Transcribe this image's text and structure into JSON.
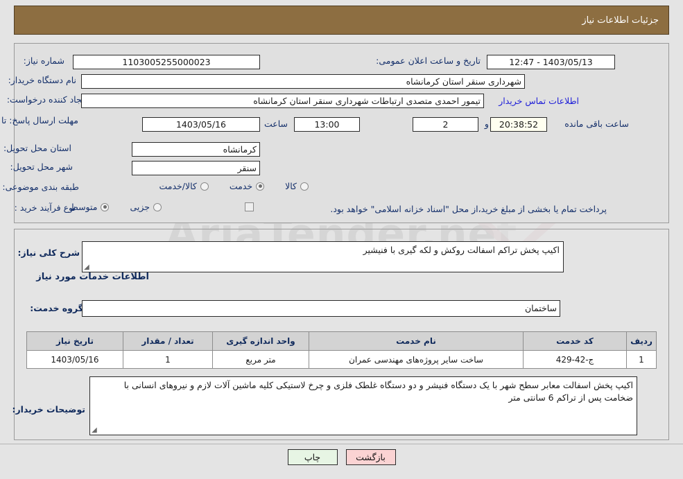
{
  "header": {
    "title": "جزئیات اطلاعات نیاز",
    "bar_color": "#8d6e41"
  },
  "watermark": {
    "text": "AriaTender.net"
  },
  "top_form": {
    "need_number_label": "شماره نیاز:",
    "need_number_value": "1103005255000023",
    "public_announce_label": "تاریخ و ساعت اعلان عمومی:",
    "public_announce_value": "1403/05/13 - 12:47",
    "buyer_org_label": "نام دستگاه خریدار:",
    "buyer_org_value": "شهرداری سنقر استان کرمانشاه",
    "buyer_org_second_value": "",
    "requester_label": "ایجاد کننده درخواست:",
    "requester_value": "تیمور احمدی متصدی ارتباطات شهرداری سنقر استان کرمانشاه",
    "contact_link": "اطلاعات تماس خریدار",
    "deadline_label": "مهلت ارسال پاسخ: تا تاریخ:",
    "deadline_date": "1403/05/16",
    "hour_label": "ساعت",
    "deadline_time": "13:00",
    "days_value": "2",
    "days_label": "روز و",
    "remaining_time": "20:38:52",
    "remaining_label": "ساعت باقی مانده",
    "province_label": "استان محل تحویل:",
    "province_value": "کرمانشاه",
    "city_label": "شهر محل تحویل:",
    "city_value": "سنقر",
    "category_label": "طبقه بندی موضوعی:",
    "category_options": [
      {
        "label": "کالا",
        "selected": false
      },
      {
        "label": "خدمت",
        "selected": true
      },
      {
        "label": "کالا/خدمت",
        "selected": false
      }
    ],
    "process_label": "نوع فرآیند خرید :",
    "process_options": [
      {
        "label": "جزیی",
        "selected": false
      },
      {
        "label": "متوسط",
        "selected": true
      }
    ],
    "treasury_checkbox_checked": false,
    "treasury_text": "پرداخت تمام یا بخشی از مبلغ خرید،از محل \"اسناد خزانه اسلامی\" خواهد بود."
  },
  "summary": {
    "label": "شرح کلی نیاز:",
    "value": "اکیپ پخش تراکم اسفالت روکش و لکه گیری با فنیشیر"
  },
  "services_section": {
    "heading": "اطلاعات خدمات مورد نیاز",
    "group_label": "گروه خدمت:",
    "group_value": "ساختمان"
  },
  "table": {
    "columns": [
      "ردیف",
      "کد خدمت",
      "نام خدمت",
      "واحد اندازه گیری",
      "تعداد / مقدار",
      "تاریخ نیاز"
    ],
    "rows": [
      {
        "index": "1",
        "code": "ج-42-429",
        "name": "ساخت سایر پروژه‌های مهندسی عمران",
        "unit": "متر مربع",
        "quantity": "1",
        "need_date": "1403/05/16"
      }
    ]
  },
  "buyer_notes": {
    "label": "توضیحات خریدار:",
    "value": "اکیپ پخش اسفالت معابر سطح شهر با یک دستگاه فنیشر و دو دستگاه غلطک فلزی و چرخ لاستیکی کلیه ماشین آلات لازم و نیروهای انسانی با ضخامت پس از تراکم 6 سانتی متر"
  },
  "footer": {
    "print_label": "چاپ",
    "back_label": "بازگشت"
  }
}
